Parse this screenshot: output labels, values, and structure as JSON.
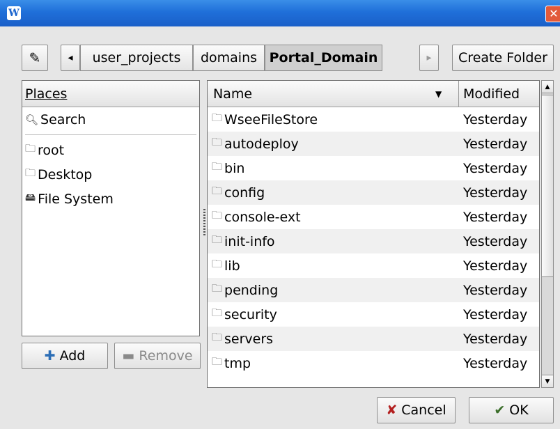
{
  "window": {
    "app_icon": "W",
    "close_glyph": "✕"
  },
  "toolbar": {
    "edit_icon": "✎",
    "back_arrow": "◂",
    "forward_arrow": "▸",
    "crumbs": [
      "user_projects",
      "domains",
      "Portal_Domain"
    ],
    "create_folder_label": "Create Folder"
  },
  "places": {
    "header": "Places",
    "items": [
      {
        "label": "Search",
        "icon": "search-icon"
      },
      {
        "label": "root",
        "icon": "folder-icon"
      },
      {
        "label": "Desktop",
        "icon": "folder-icon"
      },
      {
        "label": "File System",
        "icon": "drive-icon"
      }
    ],
    "add_label": "Add",
    "remove_label": "Remove"
  },
  "files": {
    "col_name": "Name",
    "col_modified": "Modified",
    "sort_arrow": "▼",
    "rows": [
      {
        "name": "WseeFileStore",
        "modified": "Yesterday"
      },
      {
        "name": "autodeploy",
        "modified": "Yesterday"
      },
      {
        "name": "bin",
        "modified": "Yesterday"
      },
      {
        "name": "config",
        "modified": "Yesterday"
      },
      {
        "name": "console-ext",
        "modified": "Yesterday"
      },
      {
        "name": "init-info",
        "modified": "Yesterday"
      },
      {
        "name": "lib",
        "modified": "Yesterday"
      },
      {
        "name": "pending",
        "modified": "Yesterday"
      },
      {
        "name": "security",
        "modified": "Yesterday"
      },
      {
        "name": "servers",
        "modified": "Yesterday"
      },
      {
        "name": "tmp",
        "modified": "Yesterday"
      }
    ]
  },
  "actions": {
    "cancel_label": "Cancel",
    "ok_label": "OK"
  },
  "colors": {
    "titlebar": "#1f6fd9",
    "close": "#e25a3a"
  }
}
